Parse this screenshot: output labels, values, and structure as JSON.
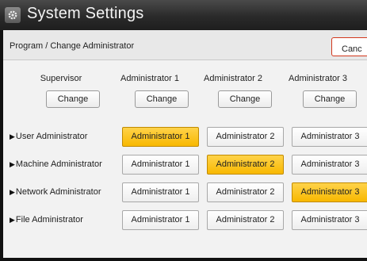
{
  "window": {
    "title": "System Settings",
    "icon": "gear-icon"
  },
  "header": {
    "label": "Program / Change Administrator",
    "cancel_label": "Canc"
  },
  "columns": [
    {
      "label": "Supervisor",
      "button": "Change"
    },
    {
      "label": "Administrator 1",
      "button": "Change"
    },
    {
      "label": "Administrator 2",
      "button": "Change"
    },
    {
      "label": "Administrator 3",
      "button": "Change"
    }
  ],
  "rows": [
    {
      "label": "User Administrator",
      "options": [
        "Administrator 1",
        "Administrator 2",
        "Administrator 3"
      ],
      "selected": 0
    },
    {
      "label": "Machine Administrator",
      "options": [
        "Administrator 1",
        "Administrator 2",
        "Administrator 3"
      ],
      "selected": 1
    },
    {
      "label": "Network Administrator",
      "options": [
        "Administrator 1",
        "Administrator 2",
        "Administrator 3"
      ],
      "selected": 2
    },
    {
      "label": "File Administrator",
      "options": [
        "Administrator 1",
        "Administrator 2",
        "Administrator 3"
      ],
      "selected": -1
    }
  ],
  "colors": {
    "selected": "#f8b800",
    "cancel_border": "#d2381d"
  }
}
